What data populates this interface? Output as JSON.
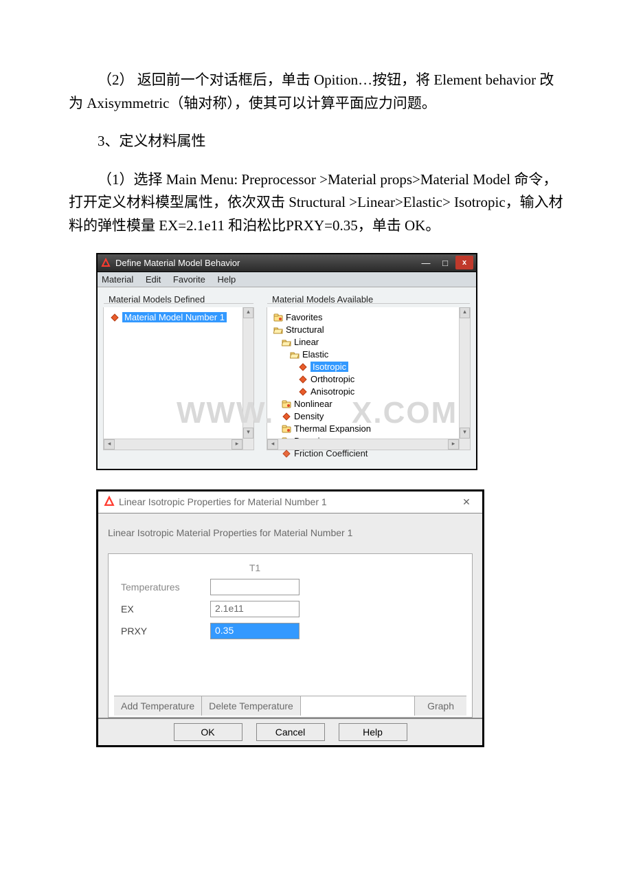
{
  "para2": "（2） 返回前一个对话框后，单击 Opition…按钮，将 Element behavior 改为 Axisymmetric（轴对称），使其可以计算平面应力问题。",
  "sect3": "3、定义材料属性",
  "para3_1": "（1）选择 Main Menu: Preprocessor >Material props>Material Model 命令，打开定义材料模型属性，依次双击 Structural >Linear>Elastic> Isotropic，输入材料的弹性模量 EX=2.1e11 和泊松比PRXY=0.35，单击 OK。",
  "watermark_left": "WWW.",
  "watermark_right": "X.COM",
  "behavior_window": {
    "title": "Define Material Model Behavior",
    "menus": [
      "Material",
      "Edit",
      "Favorite",
      "Help"
    ],
    "winbtn_min": "—",
    "winbtn_max": "□",
    "winbtn_close": "x",
    "left_panel": {
      "legend": "Material Models Defined",
      "items": [
        {
          "label": "Material Model Number 1",
          "selected": true
        }
      ]
    },
    "right_panel": {
      "legend": "Material Models Available",
      "tree": {
        "favorites": "Favorites",
        "structural": "Structural",
        "linear": "Linear",
        "elastic": "Elastic",
        "isotropic": "Isotropic",
        "orthotropic": "Orthotropic",
        "anisotropic": "Anisotropic",
        "nonlinear": "Nonlinear",
        "density": "Density",
        "thermal": "Thermal Expansion",
        "damping": "Damping",
        "friction": "Friction Coefficient"
      }
    }
  },
  "iso_dialog": {
    "title": "Linear Isotropic Properties for Material Number 1",
    "subtitle": "Linear Isotropic Material Properties for Material Number 1",
    "col_header": "T1",
    "rows": {
      "temperatures_label": "Temperatures",
      "temperatures_value": "",
      "ex_label": "EX",
      "ex_value": "2.1e11",
      "prxy_label": "PRXY",
      "prxy_value": "0.35"
    },
    "buttons": {
      "add_temp": "Add Temperature",
      "del_temp": "Delete Temperature",
      "graph": "Graph",
      "ok": "OK",
      "cancel": "Cancel",
      "help": "Help"
    },
    "close_glyph": "✕"
  }
}
